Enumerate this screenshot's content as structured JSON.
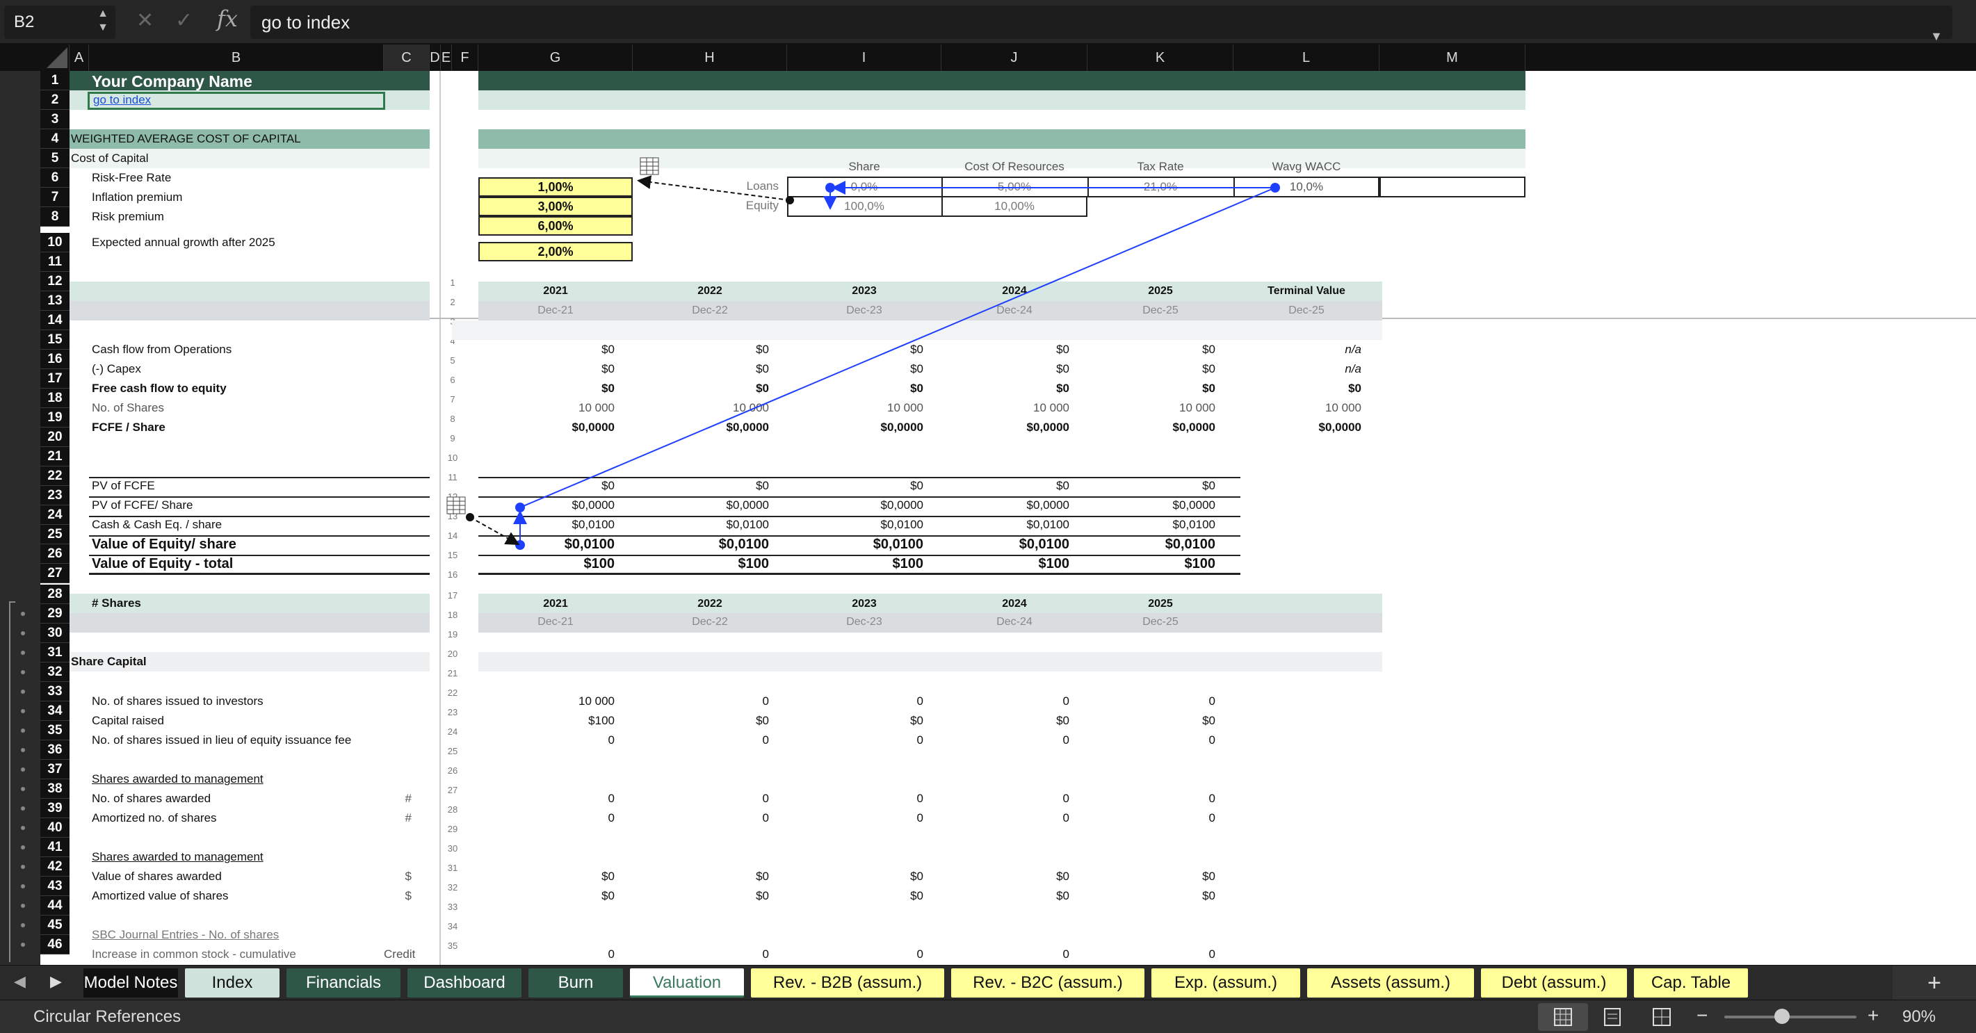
{
  "formula_bar": {
    "cell_ref": "B2",
    "formula": "go to index",
    "fx": "fx",
    "cancel": "✕",
    "ok": "✓"
  },
  "column_headers": [
    "A",
    "B",
    "C",
    "D",
    "E",
    "F",
    "G",
    "H",
    "I",
    "J",
    "K",
    "L",
    "M"
  ],
  "outline_levels": "1 2",
  "row_numbers": [
    "1",
    "2",
    "3",
    "4",
    "5",
    "6",
    "7",
    "8",
    "10",
    "11",
    "12",
    "13",
    "14",
    "15",
    "16",
    "17",
    "18",
    "19",
    "20",
    "21",
    "22",
    "23",
    "24",
    "25",
    "26",
    "27",
    "28",
    "29",
    "30",
    "31",
    "32",
    "33",
    "34",
    "35",
    "36",
    "37",
    "38",
    "39",
    "40",
    "41",
    "42",
    "43",
    "44",
    "45",
    "46"
  ],
  "helper_numbers": [
    "1",
    "2",
    "3",
    "4",
    "5",
    "6",
    "7",
    "8",
    "9",
    "10",
    "11",
    "12",
    "13",
    "14",
    "15",
    "16",
    "17",
    "18",
    "19",
    "20",
    "21",
    "22",
    "23",
    "24",
    "25",
    "26",
    "27",
    "28",
    "29",
    "30",
    "31",
    "32",
    "33",
    "34",
    "35"
  ],
  "header": {
    "company": "Your Company Name",
    "link": "go to index",
    "section_title": "WEIGHTED AVERAGE COST OF CAPITAL",
    "cost_of_capital": "Cost of Capital"
  },
  "inputs": {
    "risk_free_label": "Risk-Free Rate",
    "risk_free": "1,00%",
    "inflation_label": "Inflation premium",
    "inflation": "3,00%",
    "risk_premium_label": "Risk premium",
    "risk_premium": "6,00%",
    "growth_label": "Expected annual growth after 2025",
    "growth": "2,00%"
  },
  "wacc_table": {
    "headers": [
      "Share",
      "Cost Of Resources",
      "Tax Rate",
      "Wavg WACC"
    ],
    "loans_label": "Loans",
    "equity_label": "Equity",
    "loans": [
      "0,0%",
      "5,00%",
      "21,0%",
      "10,0%"
    ],
    "equity": [
      "100,0%",
      "10,00%"
    ]
  },
  "years": [
    "2021",
    "2022",
    "2023",
    "2024",
    "2025"
  ],
  "terminal_value": "Terminal Value",
  "dates": [
    "Dec-21",
    "Dec-22",
    "Dec-23",
    "Dec-24",
    "Dec-25"
  ],
  "terminal_date": "Dec-25",
  "fcfe": {
    "labels": [
      "Cash flow from Operations",
      "(-) Capex",
      "Free cash flow to equity",
      "No. of Shares",
      "FCFE / Share"
    ],
    "cfo": [
      "$0",
      "$0",
      "$0",
      "$0",
      "$0",
      "n/a"
    ],
    "capex": [
      "$0",
      "$0",
      "$0",
      "$0",
      "$0",
      "n/a"
    ],
    "fcf": [
      "$0",
      "$0",
      "$0",
      "$0",
      "$0",
      "$0"
    ],
    "shares": [
      "10 000",
      "10 000",
      "10 000",
      "10 000",
      "10 000",
      "10 000"
    ],
    "per_share": [
      "$0,0000",
      "$0,0000",
      "$0,0000",
      "$0,0000",
      "$0,0000",
      "$0,0000"
    ]
  },
  "valuation": {
    "labels": [
      "PV of FCFE",
      "PV of FCFE/ Share",
      "Cash & Cash Eq. / share",
      "Value of Equity/ share",
      "Value of Equity - total"
    ],
    "pv": [
      "$0",
      "$0",
      "$0",
      "$0",
      "$0"
    ],
    "pv_share": [
      "$0,0000",
      "$0,0000",
      "$0,0000",
      "$0,0000",
      "$0,0000"
    ],
    "cash_share": [
      "$0,0100",
      "$0,0100",
      "$0,0100",
      "$0,0100",
      "$0,0100"
    ],
    "eq_share": [
      "$0,0100",
      "$0,0100",
      "$0,0100",
      "$0,0100",
      "$0,0100"
    ],
    "eq_total": [
      "$100",
      "$100",
      "$100",
      "$100",
      "$100"
    ]
  },
  "shares_section": {
    "title": "# Shares",
    "share_capital": "Share Capital",
    "issued_label": "No. of shares issued to investors",
    "issued": [
      "10 000",
      "0",
      "0",
      "0",
      "0"
    ],
    "capital_label": "Capital raised",
    "capital": [
      "$100",
      "$0",
      "$0",
      "$0",
      "$0"
    ],
    "fee_label": "No. of shares issued in lieu of equity issuance fee",
    "fee": [
      "0",
      "0",
      "0",
      "0",
      "0"
    ],
    "mgmt_title_1": "Shares awarded to management",
    "awarded_label": "No. of shares awarded",
    "awarded": [
      "0",
      "0",
      "0",
      "0",
      "0"
    ],
    "amort_label": "Amortized no. of shares",
    "amort": [
      "0",
      "0",
      "0",
      "0",
      "0"
    ],
    "hash": "#",
    "mgmt_title_2": "Shares awarded to management",
    "value_awarded_label": "Value of shares awarded",
    "value_awarded": [
      "$0",
      "$0",
      "$0",
      "$0",
      "$0"
    ],
    "amort_value_label": "Amortized value of shares",
    "amort_value": [
      "$0",
      "$0",
      "$0",
      "$0",
      "$0"
    ],
    "dollar": "$",
    "sbc_title": "SBC Journal Entries - No. of shares",
    "increase_label": "Increase in common stock - cumulative",
    "credit": "Credit",
    "increase": [
      "0",
      "0",
      "0",
      "0",
      "0"
    ]
  },
  "sheet_tabs": [
    {
      "label": "Model Notes",
      "bg": "#111111",
      "fg": "#ffffff"
    },
    {
      "label": "Index",
      "bg": "#cfe3dc",
      "fg": "#111111"
    },
    {
      "label": "Financials",
      "bg": "#2f5748",
      "fg": "#ffffff"
    },
    {
      "label": "Dashboard",
      "bg": "#2f5748",
      "fg": "#ffffff"
    },
    {
      "label": "Burn",
      "bg": "#2f5748",
      "fg": "#ffffff"
    },
    {
      "label": "Valuation",
      "bg": "#ffffff",
      "fg": "#3a7a5c"
    },
    {
      "label": "Rev. - B2B (assum.)",
      "bg": "#ffff99",
      "fg": "#111111"
    },
    {
      "label": "Rev. - B2C (assum.)",
      "bg": "#ffff99",
      "fg": "#111111"
    },
    {
      "label": "Exp. (assum.)",
      "bg": "#ffff99",
      "fg": "#111111"
    },
    {
      "label": "Assets (assum.)",
      "bg": "#ffff99",
      "fg": "#111111"
    },
    {
      "label": "Debt (assum.)",
      "bg": "#ffff99",
      "fg": "#111111"
    },
    {
      "label": "Cap. Table",
      "bg": "#ffff99",
      "fg": "#111111"
    }
  ],
  "add_sheet": "+",
  "status": {
    "text": "Circular References",
    "zoom": "90%",
    "minus": "−",
    "plus": "+"
  },
  "colors": {
    "dark_green": "#2f5748",
    "mid_green": "#8fbcaa",
    "light_green": "#d6e8e1",
    "gray_band": "#dadde0",
    "yellow": "#ffff99",
    "arrow_blue": "#1f3fff"
  }
}
